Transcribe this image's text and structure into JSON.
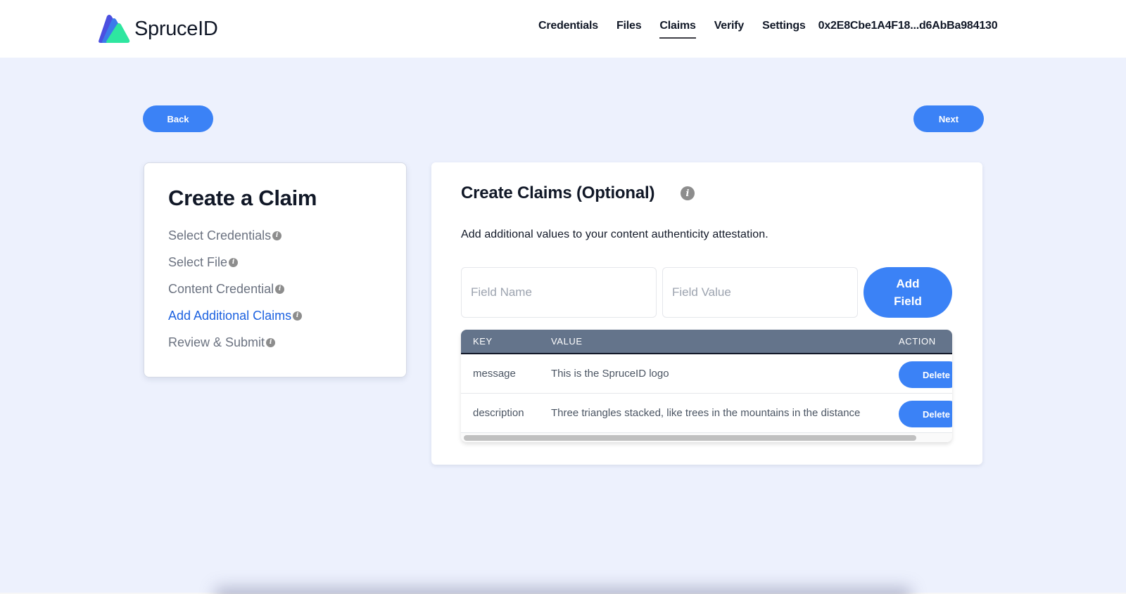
{
  "header": {
    "brand": "SpruceID",
    "logo_colors": [
      "#4b4fe0",
      "#3b7bea",
      "#2ee6a0"
    ],
    "nav": [
      {
        "label": "Credentials",
        "active": false
      },
      {
        "label": "Files",
        "active": false
      },
      {
        "label": "Claims",
        "active": true
      },
      {
        "label": "Verify",
        "active": false
      },
      {
        "label": "Settings",
        "active": false
      }
    ],
    "address": "0x2E8Cbe1A4F18...d6AbBa984130"
  },
  "actions": {
    "back_label": "Back",
    "next_label": "Next"
  },
  "steps": {
    "title": "Create a Claim",
    "items": [
      {
        "label": "Select Credentials",
        "icon": "info-icon",
        "active": false
      },
      {
        "label": "Select File",
        "icon": "info-icon",
        "active": false
      },
      {
        "label": "Content Credential",
        "icon": "info-icon",
        "active": false
      },
      {
        "label": "Add Additional Claims",
        "icon": "info-icon",
        "active": true
      },
      {
        "label": "Review & Submit",
        "icon": "info-icon",
        "active": false
      }
    ]
  },
  "claims": {
    "title": "Create Claims (Optional)",
    "info_icon": "i",
    "description": "Add additional values to your content authenticity attestation.",
    "field_name_placeholder": "Field Name",
    "field_value_placeholder": "Field Value",
    "field_name_value": "",
    "field_value_value": "",
    "add_field_label_line1": "Add",
    "add_field_label_line2": "Field",
    "table": {
      "columns": [
        "KEY",
        "VALUE",
        "ACTION"
      ],
      "rows": [
        {
          "key": "message",
          "value": "This is the SpruceID logo",
          "action": "Delete"
        },
        {
          "key": "description",
          "value": "Three triangles stacked, like trees in the mountains in the distance",
          "action": "Delete"
        }
      ]
    }
  },
  "colors": {
    "accent": "#3b82f6",
    "active_step": "#1d62e0",
    "table_header": "#64748b",
    "background": "#edf1fd"
  }
}
